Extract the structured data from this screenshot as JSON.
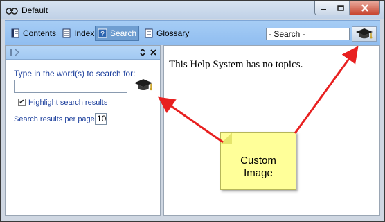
{
  "window": {
    "title": "Default"
  },
  "toolbar": {
    "tabs": [
      {
        "label": "Contents"
      },
      {
        "label": "Index"
      },
      {
        "label": "Search"
      },
      {
        "label": "Glossary"
      }
    ],
    "search_value": "- Search -"
  },
  "left_pane": {
    "search_label": "Type in the word(s) to search for:",
    "highlight_label": "Highlight search results",
    "highlight_checked": true,
    "per_page_label": "Search results per page",
    "per_page_value": "10"
  },
  "right_pane": {
    "message": "This Help System has no topics."
  },
  "callout": {
    "text": "Custom\nImage"
  },
  "colors": {
    "accent": "#a6cdf5",
    "active_tab": "#6f9ed1",
    "callout": "#ffff99",
    "arrow": "#e82020"
  },
  "icons": [
    "app-icon",
    "minimize-icon",
    "maximize-icon",
    "close-icon",
    "book-icon",
    "index-icon",
    "search-icon",
    "glossary-icon",
    "graduation-cap-icon",
    "sync-icon",
    "pane-close-icon"
  ]
}
